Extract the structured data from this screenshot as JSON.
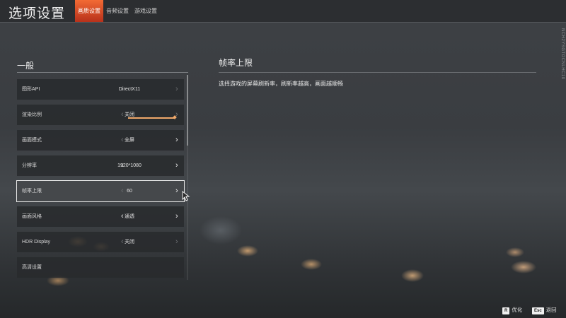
{
  "header": {
    "title": "选项设置",
    "tabs": [
      {
        "label": "画质设置",
        "active": true
      },
      {
        "label": "音频设置",
        "active": false
      },
      {
        "label": "游戏设置",
        "active": false
      }
    ],
    "side_id": "NCH2YSGTOCNLHC10"
  },
  "section": {
    "title": "一般"
  },
  "settings": [
    {
      "label": "图形API",
      "value": "DirectX11",
      "left_enabled": false,
      "right_enabled": false,
      "selected": false
    },
    {
      "label": "渲染比例",
      "value": "关闭",
      "left_enabled": false,
      "right_enabled": false,
      "selected": false,
      "slider_level": 1.0
    },
    {
      "label": "画面模式",
      "value": "全屏",
      "left_enabled": false,
      "right_enabled": true,
      "selected": false
    },
    {
      "label": "分辨率",
      "value": "1920*1080",
      "left_enabled": true,
      "right_enabled": true,
      "selected": false
    },
    {
      "label": "帧率上限",
      "value": "60",
      "left_enabled": false,
      "right_enabled": true,
      "selected": true
    },
    {
      "label": "画面风格",
      "value": "通透",
      "left_enabled": true,
      "right_enabled": true,
      "selected": false
    },
    {
      "label": "HDR Display",
      "value": "关闭",
      "left_enabled": false,
      "right_enabled": false,
      "selected": false
    },
    {
      "label": "高清设置",
      "value": "",
      "left_enabled": false,
      "right_enabled": false,
      "selected": false
    }
  ],
  "detail": {
    "title": "帧率上限",
    "description": "选择游戏的屏幕刷新率，刷新率越高，画面越顺畅"
  },
  "footer": {
    "hints": [
      {
        "key": "R",
        "label": "优化"
      },
      {
        "key": "Esc",
        "label": "返回"
      }
    ]
  },
  "colors": {
    "accent": "#e14d28",
    "slider": "#f0a86a"
  },
  "icons": {
    "arrow_left": "chevron-left-icon",
    "arrow_right": "chevron-right-icon",
    "cursor": "mouse-pointer-icon"
  }
}
